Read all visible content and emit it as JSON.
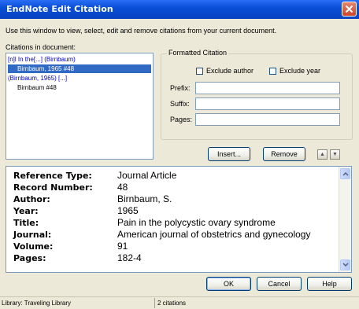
{
  "window": {
    "title": "EndNote Edit Citation"
  },
  "instructions": "Use this window to view, select, edit and remove citations from your current document.",
  "citations": {
    "label": "Citations in document:",
    "items": [
      {
        "text": "[n]l In the[...] (Birnbaum)",
        "style": "blue"
      },
      {
        "text": "Birnbaum, 1965 #48",
        "style": "selected"
      },
      {
        "text": "(Birnbaum, 1965) [...]",
        "style": "blue"
      },
      {
        "text": "Birnbaum #48",
        "style": "normal"
      }
    ]
  },
  "formatted": {
    "label": "Formatted Citation",
    "exclude_author": "Exclude author",
    "exclude_year": "Exclude year",
    "prefix_label": "Prefix:",
    "suffix_label": "Suffix:",
    "pages_label": "Pages:",
    "prefix_value": "",
    "suffix_value": "",
    "pages_value": ""
  },
  "buttons": {
    "insert": "Insert...",
    "remove": "Remove",
    "ok": "OK",
    "cancel": "Cancel",
    "help": "Help"
  },
  "details": [
    {
      "label": "Reference Type:",
      "value": "Journal Article"
    },
    {
      "label": "Record Number:",
      "value": "48"
    },
    {
      "label": "Author:",
      "value": "Birnbaum, S."
    },
    {
      "label": "Year:",
      "value": "1965"
    },
    {
      "label": "Title:",
      "value": "Pain in the polycystic ovary syndrome"
    },
    {
      "label": "Journal:",
      "value": "American journal of obstetrics and gynecology"
    },
    {
      "label": "Volume:",
      "value": "91"
    },
    {
      "label": "Pages:",
      "value": "182-4"
    }
  ],
  "status": {
    "library": "Library: Traveling Library",
    "count": "2 citations"
  }
}
